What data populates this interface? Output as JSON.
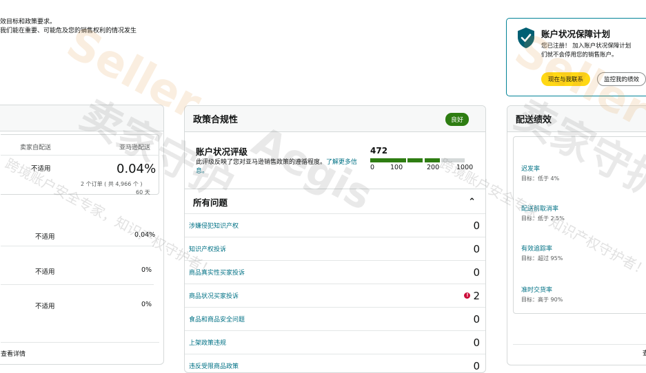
{
  "intro": {
    "line1": "效目标和政策要求。",
    "line2": "我们能在重要、可能危及您的销售权利的情况发生"
  },
  "left_card": {
    "col1": "卖家自配送",
    "col2": "亚马逊配送",
    "top_val1": "不适用",
    "top_val2": "0.04%",
    "top_sub1": "2 个订单 ( 共 4,966 个 )",
    "top_sub2": "60 天",
    "rows": [
      {
        "a": "不适用",
        "b": "0.04%"
      },
      {
        "a": "不适用",
        "b": "0%"
      },
      {
        "a": "不适用",
        "b": "0%"
      }
    ],
    "details_link": "查看详情"
  },
  "policy": {
    "title": "政策合规性",
    "badge": "良好",
    "ahr_title": "账户状况评级",
    "ahr_desc": "此评级反映了您对亚马逊销售政策的遵循程度。",
    "ahr_link": "了解更多信息。",
    "score": "472",
    "scale": [
      "0",
      "100",
      "200",
      "1000"
    ],
    "issues_title": "所有问题",
    "issues": [
      {
        "label": "涉嫌侵犯知识产权",
        "count": "0"
      },
      {
        "label": "知识产权投诉",
        "count": "0"
      },
      {
        "label": "商品真实性买家投诉",
        "count": "0"
      },
      {
        "label": "商品状况买家投诉",
        "count": "2",
        "alert": "!"
      },
      {
        "label": "食品和商品安全问题",
        "count": "0"
      },
      {
        "label": "上架政策违规",
        "count": "0"
      },
      {
        "label": "违反受限商品政策",
        "count": "0"
      }
    ]
  },
  "banner": {
    "title": "账户状况保障计划",
    "line1": "您已注册！ 加入账户状况保障计划",
    "line2": "们就不会停用您的销售账户。",
    "btn_contact": "现在与我联系",
    "btn_monitor": "监控我的绩效"
  },
  "shipping": {
    "title": "配送绩效",
    "metrics": [
      {
        "name": "迟发率",
        "target": "目标：低于 4%"
      },
      {
        "name": "配送前取消率",
        "target": "目标：低于 2.5%"
      },
      {
        "name": "有效追踪率",
        "target": "目标：超过 95%"
      },
      {
        "name": "准时交货率",
        "target": "目标：高于 90%"
      }
    ],
    "more": "查"
  },
  "watermark": {
    "brand": "Seller",
    "brand2": "Aegis",
    "cn": "卖家守护",
    "slogan": "跨境账户安全专家，知识产权守护者！"
  },
  "colors": {
    "accent": "#007185",
    "good": "#2e7d12",
    "alert": "#cc0c39",
    "button": "#ffd814"
  }
}
